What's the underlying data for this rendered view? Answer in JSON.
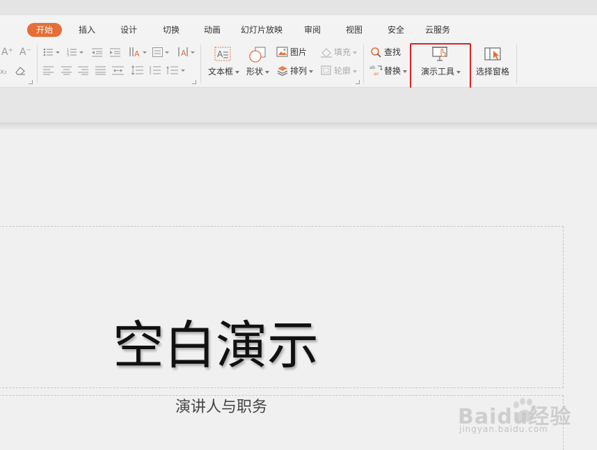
{
  "tabs": [
    {
      "label": "开始",
      "active": true
    },
    {
      "label": "插入"
    },
    {
      "label": "设计"
    },
    {
      "label": "切换"
    },
    {
      "label": "动画"
    },
    {
      "label": "幻灯片放映"
    },
    {
      "label": "审阅"
    },
    {
      "label": "视图"
    },
    {
      "label": "安全"
    },
    {
      "label": "云服务"
    }
  ],
  "ribbon": {
    "textbox": "文本框",
    "shape": "形状",
    "picture": "图片",
    "arrange": "排列",
    "fill": "填充",
    "outline": "轮廓",
    "find": "查找",
    "replace": "替换",
    "presentation_tools": "演示工具",
    "selection_pane": "选择窗格",
    "font_grow_glyph": "A⁺",
    "font_shrink_glyph": "A⁻"
  },
  "slide": {
    "title": "空白演示",
    "subtitle": "演讲人与职务"
  },
  "watermark": {
    "brand": "Baidu经验",
    "url": "jingyan.baidu.com"
  },
  "colors": {
    "accent": "#e56e36",
    "highlight": "#e02020"
  }
}
